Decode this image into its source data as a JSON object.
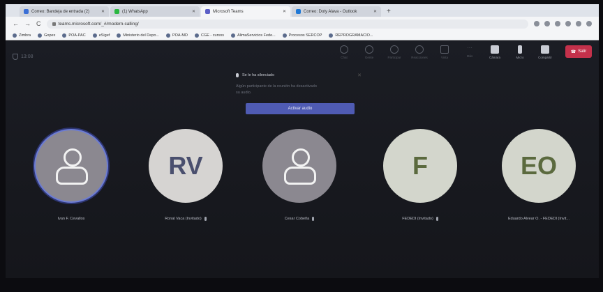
{
  "browser": {
    "tabs": [
      {
        "label": "Correo: Bandeja de entrada (2)",
        "color": "#3b6fd6",
        "active": false
      },
      {
        "label": "(1) WhatsApp",
        "color": "#2bb741",
        "active": false
      },
      {
        "label": "Microsoft Teams",
        "color": "#5b5fc7",
        "active": true
      },
      {
        "label": "Correo: Doty Alava - Outlook",
        "color": "#1e78d6",
        "active": false
      }
    ],
    "new_tab": "+",
    "url": "teams.microsoft.com/_#/modern-calling/",
    "bookmarks": [
      "Zimbra",
      "Gopex",
      "POA-PAC",
      "eSigef",
      "Ministerio del Depo...",
      "POA-MD",
      "CGE - cursos",
      "AlimaServicios Fede...",
      "Procesos SERCOP",
      "REPROGRAMACIO..."
    ]
  },
  "meeting": {
    "timer": "13:08",
    "controls": [
      {
        "label": "Chat",
        "icon": "chat-icon"
      },
      {
        "label": "Gente",
        "icon": "people-icon"
      },
      {
        "label": "Participar",
        "icon": "raise-hand-icon"
      },
      {
        "label": "Reacciones",
        "icon": "reaction-icon"
      },
      {
        "label": "Vista",
        "icon": "view-icon"
      },
      {
        "label": "Más",
        "icon": "more-icon"
      },
      {
        "label": "Cámara",
        "icon": "camera-off-icon"
      },
      {
        "label": "Micro",
        "icon": "mic-off-icon"
      },
      {
        "label": "Compartir",
        "icon": "share-icon"
      }
    ],
    "leave_label": "Salir",
    "notification": {
      "title": "Se le ha silenciado",
      "body": "Algún participante de la reunión ha desactivado su audio.",
      "button": "Activar audio"
    },
    "participants": [
      {
        "name": "Ivan F. Cevallos",
        "initials": "",
        "style": "grey",
        "active": true,
        "muted": false
      },
      {
        "name": "Ronal Vaca (Invitado)",
        "initials": "RV",
        "style": "light",
        "active": false,
        "muted": true
      },
      {
        "name": "Cesar Cobeña",
        "initials": "",
        "style": "grey",
        "active": false,
        "muted": true
      },
      {
        "name": "FEDEDI (Invitado)",
        "initials": "F",
        "style": "light green",
        "active": false,
        "muted": true
      },
      {
        "name": "Eduardo Alvear O. - FEDEDI (Invit...",
        "initials": "EO",
        "style": "light green",
        "active": false,
        "muted": false
      }
    ]
  }
}
